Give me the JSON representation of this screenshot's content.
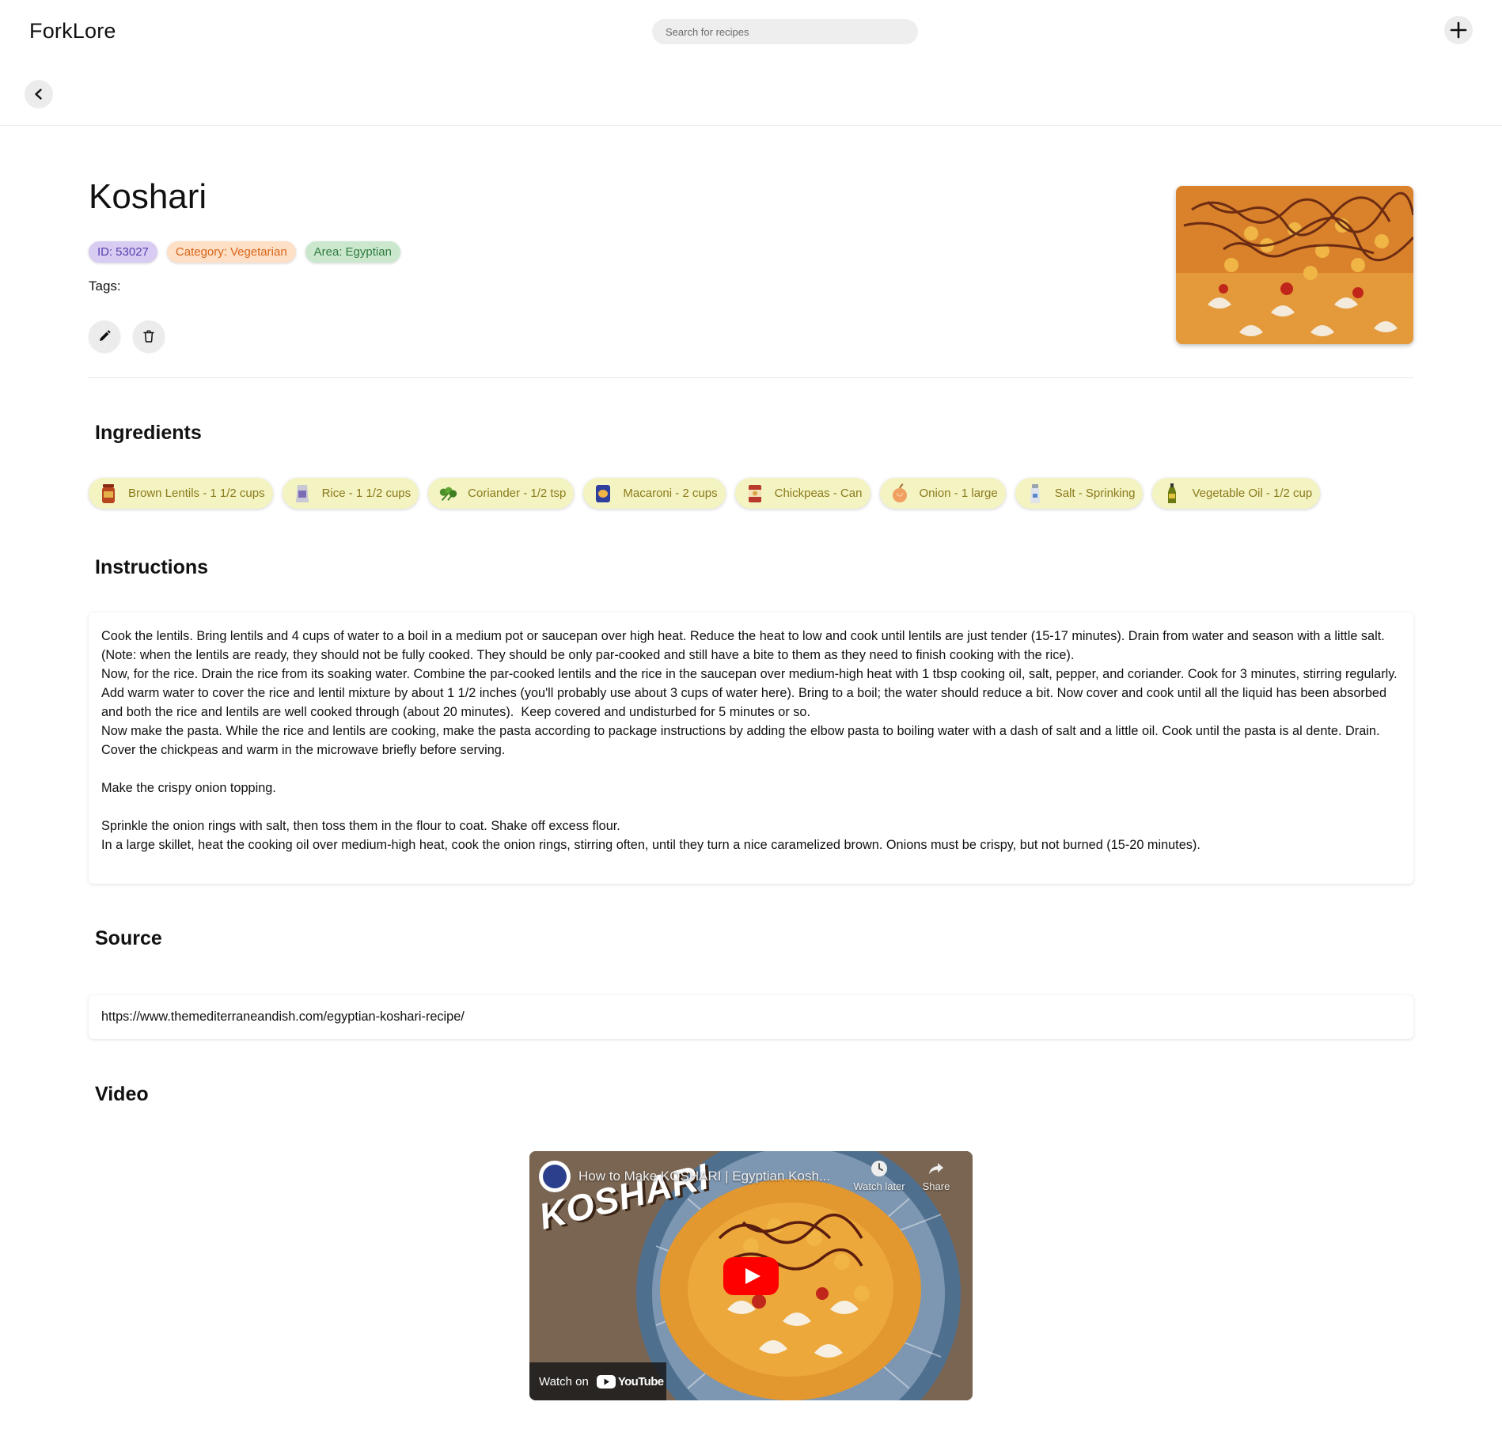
{
  "app": {
    "brand": "ForkLore",
    "search_placeholder": "Search for recipes"
  },
  "recipe": {
    "title": "Koshari",
    "badges": {
      "id_key": "ID:",
      "id_value": "53027",
      "category_key": "Category:",
      "category_value": "Vegetarian",
      "area_key": "Area:",
      "area_value": "Egyptian"
    },
    "tags_label": "Tags:"
  },
  "sections": {
    "ingredients": "Ingredients",
    "instructions": "Instructions",
    "source": "Source",
    "video": "Video"
  },
  "ingredients": [
    {
      "label": "Brown Lentils - 1 1/2 cups",
      "icon": "lentils-jar-icon"
    },
    {
      "label": "Rice - 1 1/2 cups",
      "icon": "rice-bag-icon"
    },
    {
      "label": "Coriander - 1/2 tsp",
      "icon": "coriander-leaf-icon"
    },
    {
      "label": "Macaroni - 2 cups",
      "icon": "macaroni-pack-icon"
    },
    {
      "label": "Chickpeas - Can",
      "icon": "chickpeas-can-icon"
    },
    {
      "label": "Onion - 1 large",
      "icon": "onion-icon"
    },
    {
      "label": "Salt - Sprinking",
      "icon": "salt-shaker-icon"
    },
    {
      "label": "Vegetable Oil - 1/2 cup",
      "icon": "oil-bottle-icon"
    }
  ],
  "instructions_text": "Cook the lentils. Bring lentils and 4 cups of water to a boil in a medium pot or saucepan over high heat. Reduce the heat to low and cook until lentils are just tender (15-17 minutes). Drain from water and season with a little salt. (Note: when the lentils are ready, they should not be fully cooked. They should be only par-cooked and still have a bite to them as they need to finish cooking with the rice).\nNow, for the rice. Drain the rice from its soaking water. Combine the par-cooked lentils and the rice in the saucepan over medium-high heat with 1 tbsp cooking oil, salt, pepper, and coriander. Cook for 3 minutes, stirring regularly. Add warm water to cover the rice and lentil mixture by about 1 1/2 inches (you'll probably use about 3 cups of water here). Bring to a boil; the water should reduce a bit. Now cover and cook until all the liquid has been absorbed and both the rice and lentils are well cooked through (about 20 minutes).  Keep covered and undisturbed for 5 minutes or so.\nNow make the pasta. While the rice and lentils are cooking, make the pasta according to package instructions by adding the elbow pasta to boiling water with a dash of salt and a little oil. Cook until the pasta is al dente. Drain.\nCover the chickpeas and warm in the microwave briefly before serving.\n\nMake the crispy onion topping.\n\nSprinkle the onion rings with salt, then toss them in the flour to coat. Shake off excess flour.\nIn a large skillet, heat the cooking oil over medium-high heat, cook the onion rings, stirring often, until they turn a nice caramelized brown. Onions must be crispy, but not burned (15-20 minutes).",
  "source_url": "https://www.themediterraneandish.com/egyptian-koshari-recipe/",
  "video": {
    "title": "How to Make KOSHARI | Egyptian Kosh...",
    "overlay_text": "KOSHARI",
    "watch_later": "Watch later",
    "share": "Share",
    "watch_on": "Watch on",
    "youtube": "YouTube"
  },
  "colors": {
    "badge_id": "#d8ccf2",
    "badge_category": "#fde0c6",
    "badge_area": "#cbe8cf",
    "chip_bg": "#f4f3c2",
    "youtube_red": "#ff0000"
  }
}
